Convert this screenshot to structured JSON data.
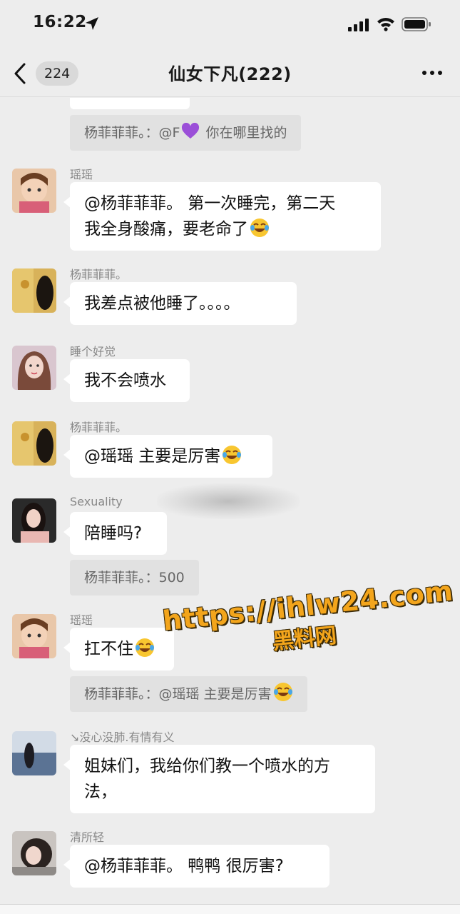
{
  "status_bar": {
    "time": "16:22"
  },
  "header": {
    "unread_count": "224",
    "title": "仙女下凡(222)"
  },
  "messages": [
    {
      "type": "quote",
      "text": "杨菲菲菲。：@F",
      "text_after": " 你在哪里找的"
    },
    {
      "type": "message",
      "sender": "瑶瑶",
      "lines": [
        "@杨菲菲菲。 第一次睡完，第二天",
        "我全身酸痛，要老命了"
      ]
    },
    {
      "type": "message",
      "sender": "杨菲菲菲。",
      "text": "我差点被他睡了。。。。"
    },
    {
      "type": "message",
      "sender": "睡个好觉",
      "text": "我不会喷水"
    },
    {
      "type": "message",
      "sender": "杨菲菲菲。",
      "text": "@瑶瑶 主要是厉害"
    },
    {
      "type": "message",
      "sender": "Sexuality",
      "text": "陪睡吗?"
    },
    {
      "type": "quote",
      "text": "杨菲菲菲。：500"
    },
    {
      "type": "message",
      "sender": "瑶瑶",
      "text": "扛不住"
    },
    {
      "type": "quote",
      "text": "杨菲菲菲。：@瑶瑶 主要是厉害"
    },
    {
      "type": "message",
      "sender": "↘没心没肺.有情有义",
      "lines": [
        "姐妹们，我给你们教一个喷水的方",
        "法，"
      ]
    },
    {
      "type": "message",
      "sender": "清所轻",
      "text": "@杨菲菲菲。 鸭鸭 很厉害?"
    }
  ],
  "watermark": {
    "url": "https://ihlw24.com",
    "label": "黑料网"
  },
  "colors": {
    "background": "#ededed",
    "bubble": "#ffffff",
    "quote": "#e1e1e1",
    "watermark": "#f3a51c"
  },
  "icons": [
    "location-arrow-icon",
    "signal-icon",
    "wifi-icon",
    "battery-icon",
    "back-chevron-icon",
    "more-dots-icon",
    "purple-heart-emoji",
    "laughing-tears-emoji"
  ]
}
